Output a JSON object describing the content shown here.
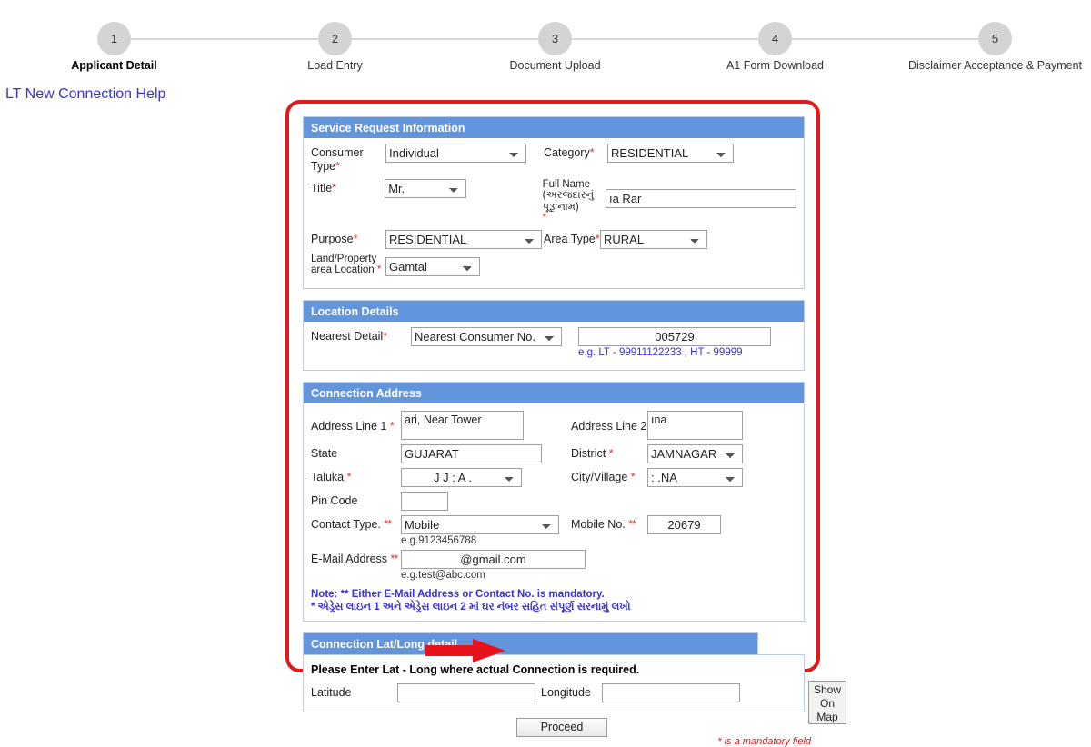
{
  "stepper": {
    "steps": [
      {
        "num": "1",
        "label": "Applicant Detail"
      },
      {
        "num": "2",
        "label": "Load Entry"
      },
      {
        "num": "3",
        "label": "Document Upload"
      },
      {
        "num": "4",
        "label": "A1 Form Download"
      },
      {
        "num": "5",
        "label": "Disclaimer Acceptance & Payment"
      }
    ]
  },
  "help_link": "LT New Connection Help",
  "service_request": {
    "title": "Service Request Information",
    "consumer_type_label": "Consumer Type",
    "consumer_type_value": "Individual",
    "category_label": "Category",
    "category_value": "RESIDENTIAL",
    "title_label": "Title",
    "title_value": "Mr.",
    "full_name_label_en": "Full Name",
    "full_name_label_gu": "(અરજદારનું પૂરૂ નામ)",
    "full_name_value": "ıa Rar",
    "purpose_label": "Purpose",
    "purpose_value": "RESIDENTIAL",
    "area_type_label": "Area Type",
    "area_type_value": "RURAL",
    "land_location_label_1": "Land/Property",
    "land_location_label_2": "area Location",
    "land_location_value": "Gamtal"
  },
  "location_details": {
    "title": "Location Details",
    "nearest_detail_label": "Nearest Detail",
    "nearest_detail_value": "Nearest Consumer No.",
    "consumer_no_value": "005729",
    "hint": "e.g. LT - 99911122233 , HT - 99999"
  },
  "connection_address": {
    "title": "Connection Address",
    "address1_label": "Address Line 1",
    "address1_value": "ari, Near Tower",
    "address2_label": "Address Line 2",
    "address2_value": "ına",
    "state_label": "State",
    "state_value": "GUJARAT",
    "district_label": "District",
    "district_value": "JAMNAGAR",
    "taluka_label": "Taluka",
    "taluka_value": "J  J  :  A  .",
    "city_label": "City/Village",
    "city_value": ":   .NA",
    "pincode_label": "Pin Code",
    "pincode_value": "",
    "contact_type_label": "Contact Type.",
    "contact_type_value": "Mobile",
    "mobile_label": "Mobile No.",
    "mobile_value": "20679",
    "mobile_hint": "e.g.9123456788",
    "email_label": "E-Mail Address",
    "email_value": "@gmail.com",
    "email_hint": "e.g.test@abc.com",
    "note_en": "Note: ** Either E-Mail Address or Contact No. is mandatory.",
    "note_gu": "* એડ્રેસ લાઇન 1 અને એડ્રેસ લાઇન 2 માં ઘર નંબર સહિત સંપૂર્ણ સરનામું લખો"
  },
  "latlong": {
    "title": "Connection Lat/Long detail",
    "instruction": "Please Enter Lat - Long where actual Connection is required.",
    "latitude_label": "Latitude",
    "latitude_value": "",
    "longitude_label": "Longitude",
    "longitude_value": "",
    "show_on_map_line1": "Show",
    "show_on_map_line2": "On",
    "show_on_map_line3": "Map"
  },
  "footer": {
    "proceed_label": "Proceed",
    "mandatory_note": "* is a mandatory field"
  },
  "colors": {
    "section_header_blue": "#6395dd",
    "annotation_red": "#e01b1b",
    "link_blue": "#3a32d6",
    "required_red": "#e03030"
  }
}
